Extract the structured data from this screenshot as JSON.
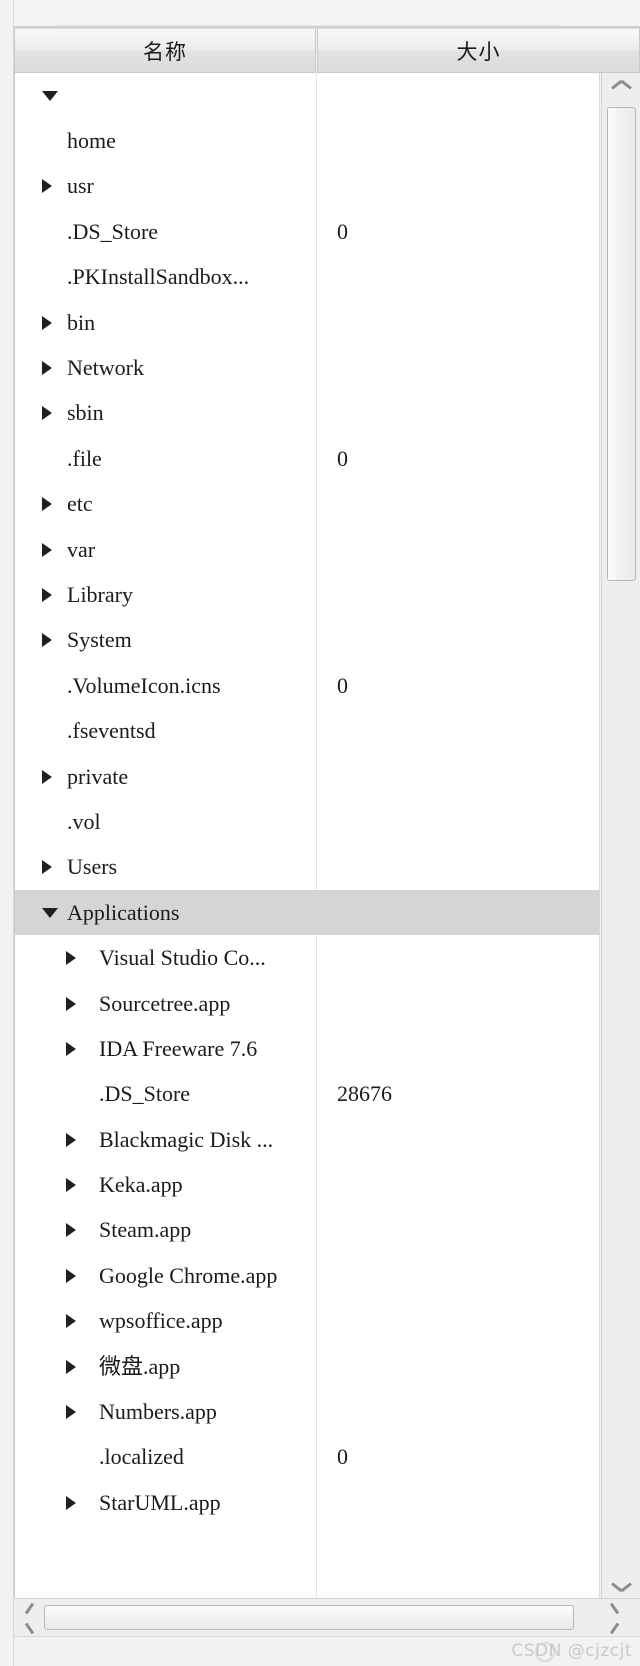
{
  "window": {
    "columns": [
      {
        "key": "name",
        "label": "名称"
      },
      {
        "key": "size",
        "label": "大小"
      }
    ]
  },
  "tree": {
    "rows": [
      {
        "label": "",
        "size": "",
        "level": 0,
        "twisty": "open",
        "selected": false
      },
      {
        "label": "home",
        "size": "",
        "level": 0,
        "twisty": "none",
        "selected": false
      },
      {
        "label": "usr",
        "size": "",
        "level": 0,
        "twisty": "closed",
        "selected": false
      },
      {
        "label": ".DS_Store",
        "size": "0",
        "level": 0,
        "twisty": "none",
        "selected": false
      },
      {
        "label": ".PKInstallSandbox...",
        "size": "",
        "level": 0,
        "twisty": "none",
        "selected": false
      },
      {
        "label": "bin",
        "size": "",
        "level": 0,
        "twisty": "closed",
        "selected": false
      },
      {
        "label": "Network",
        "size": "",
        "level": 0,
        "twisty": "closed",
        "selected": false
      },
      {
        "label": "sbin",
        "size": "",
        "level": 0,
        "twisty": "closed",
        "selected": false
      },
      {
        "label": ".file",
        "size": "0",
        "level": 0,
        "twisty": "none",
        "selected": false
      },
      {
        "label": "etc",
        "size": "",
        "level": 0,
        "twisty": "closed",
        "selected": false
      },
      {
        "label": "var",
        "size": "",
        "level": 0,
        "twisty": "closed",
        "selected": false
      },
      {
        "label": "Library",
        "size": "",
        "level": 0,
        "twisty": "closed",
        "selected": false
      },
      {
        "label": "System",
        "size": "",
        "level": 0,
        "twisty": "closed",
        "selected": false
      },
      {
        "label": ".VolumeIcon.icns",
        "size": "0",
        "level": 0,
        "twisty": "none",
        "selected": false
      },
      {
        "label": ".fseventsd",
        "size": "",
        "level": 0,
        "twisty": "none",
        "selected": false
      },
      {
        "label": "private",
        "size": "",
        "level": 0,
        "twisty": "closed",
        "selected": false
      },
      {
        "label": ".vol",
        "size": "",
        "level": 0,
        "twisty": "none",
        "selected": false
      },
      {
        "label": "Users",
        "size": "",
        "level": 0,
        "twisty": "closed",
        "selected": false
      },
      {
        "label": "Applications",
        "size": "",
        "level": 0,
        "twisty": "open",
        "selected": true
      },
      {
        "label": "Visual Studio Co...",
        "size": "",
        "level": 1,
        "twisty": "closed",
        "selected": false
      },
      {
        "label": "Sourcetree.app",
        "size": "",
        "level": 1,
        "twisty": "closed",
        "selected": false
      },
      {
        "label": "IDA Freeware 7.6",
        "size": "",
        "level": 1,
        "twisty": "closed",
        "selected": false
      },
      {
        "label": ".DS_Store",
        "size": "28676",
        "level": 1,
        "twisty": "none",
        "selected": false
      },
      {
        "label": "Blackmagic Disk ...",
        "size": "",
        "level": 1,
        "twisty": "closed",
        "selected": false
      },
      {
        "label": "Keka.app",
        "size": "",
        "level": 1,
        "twisty": "closed",
        "selected": false
      },
      {
        "label": "Steam.app",
        "size": "",
        "level": 1,
        "twisty": "closed",
        "selected": false
      },
      {
        "label": "Google Chrome.app",
        "size": "",
        "level": 1,
        "twisty": "closed",
        "selected": false
      },
      {
        "label": "wpsoffice.app",
        "size": "",
        "level": 1,
        "twisty": "closed",
        "selected": false
      },
      {
        "label": "微盘.app",
        "size": "",
        "level": 1,
        "twisty": "closed",
        "selected": false
      },
      {
        "label": "Numbers.app",
        "size": "",
        "level": 1,
        "twisty": "closed",
        "selected": false
      },
      {
        "label": ".localized",
        "size": "0",
        "level": 1,
        "twisty": "none",
        "selected": false
      },
      {
        "label": "StarUML.app",
        "size": "",
        "level": 1,
        "twisty": "closed",
        "selected": false
      }
    ]
  },
  "scrollbars": {
    "vertical": {
      "up_icon": "chevron-up-icon",
      "down_icon": "chevron-down-icon"
    },
    "horizontal": {
      "left_icon": "chevron-left-icon",
      "right_icon": "chevron-right-icon"
    }
  },
  "footer": {
    "watermark": "CSDN @cjzcjt"
  }
}
